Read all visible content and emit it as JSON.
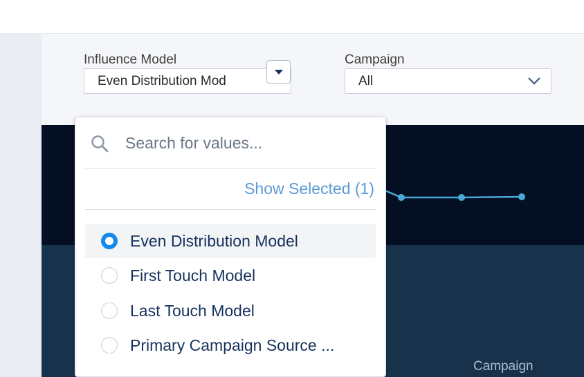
{
  "filters": {
    "influence_model": {
      "label": "Influence Model",
      "value": "Even Distribution Mod"
    },
    "campaign": {
      "label": "Campaign",
      "value": "All"
    }
  },
  "dropdown": {
    "search_placeholder": "Search for values...",
    "show_selected": "Show Selected (1)",
    "options": [
      {
        "label": "Even Distribution Model",
        "selected": true
      },
      {
        "label": "First Touch Model",
        "selected": false
      },
      {
        "label": "Last Touch Model",
        "selected": false
      },
      {
        "label": "Primary Campaign Source ...",
        "selected": false
      }
    ]
  },
  "chart": {
    "axis_label": "Campaign"
  },
  "colors": {
    "accent": "#1589ee",
    "link": "#5a9bd5",
    "series": "#4aa9d6"
  }
}
